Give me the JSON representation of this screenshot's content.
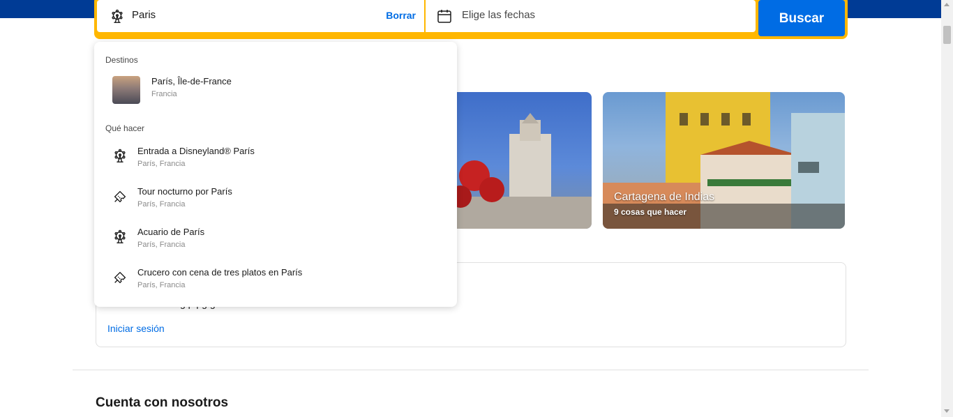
{
  "search": {
    "destination_value": "Paris",
    "clear_label": "Borrar",
    "date_placeholder": "Elige las fechas",
    "search_button": "Buscar"
  },
  "cards": [
    {
      "title": "",
      "subtitle": ""
    },
    {
      "title": "Cartagena de Indias",
      "subtitle": "9 cosas que hacer"
    }
  ],
  "signin": {
    "message": "g   p                                        pg  guardados",
    "link": "Iniciar sesión"
  },
  "section": {
    "title": "Cuenta con nosotros"
  },
  "dropdown": {
    "destinations_heading": "Destinos",
    "destinations": [
      {
        "title": "París, Île-de-France",
        "subtitle": "Francia",
        "icon": "city-photo-thumbnail"
      }
    ],
    "activities_heading": "Qué hacer",
    "activities": [
      {
        "title": "Entrada a Disneyland® París",
        "subtitle": "París, Francia",
        "icon": "ferris-wheel-icon"
      },
      {
        "title": "Tour nocturno por París",
        "subtitle": "París, Francia",
        "icon": "ticket-icon"
      },
      {
        "title": "Acuario de París",
        "subtitle": "París, Francia",
        "icon": "ferris-wheel-icon"
      },
      {
        "title": "Crucero con cena de tres platos en París",
        "subtitle": "París, Francia",
        "icon": "ticket-icon"
      }
    ]
  },
  "colors": {
    "brand_blue": "#003b95",
    "action_blue": "#006ce4",
    "search_border": "#ffb700"
  }
}
